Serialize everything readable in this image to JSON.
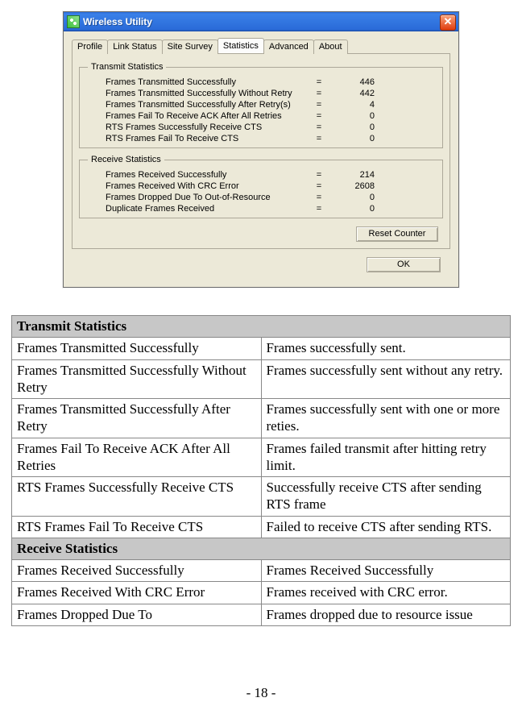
{
  "window": {
    "title": "Wireless Utility",
    "tabs": [
      "Profile",
      "Link Status",
      "Site Survey",
      "Statistics",
      "Advanced",
      "About"
    ],
    "activeTab": 3,
    "transmit": {
      "legend": "Transmit Statistics",
      "rows": [
        {
          "label": "Frames Transmitted Successfully",
          "value": "446"
        },
        {
          "label": "Frames Transmitted Successfully Without Retry",
          "value": "442"
        },
        {
          "label": "Frames Transmitted Successfully After Retry(s)",
          "value": "4"
        },
        {
          "label": "Frames Fail To Receive ACK After All Retries",
          "value": "0"
        },
        {
          "label": "RTS Frames Successfully Receive CTS",
          "value": "0"
        },
        {
          "label": "RTS Frames Fail To Receive CTS",
          "value": "0"
        }
      ]
    },
    "receive": {
      "legend": "Receive Statistics",
      "rows": [
        {
          "label": "Frames Received Successfully",
          "value": "214"
        },
        {
          "label": "Frames Received With CRC Error",
          "value": "2608"
        },
        {
          "label": "Frames Dropped Due To Out-of-Resource",
          "value": "0"
        },
        {
          "label": "Duplicate Frames Received",
          "value": "0"
        }
      ]
    },
    "buttons": {
      "reset": "Reset Counter",
      "ok": "OK"
    }
  },
  "defs": {
    "sections": [
      {
        "header": "Transmit Statistics",
        "rows": [
          {
            "l": "Frames Transmitted Successfully",
            "r": "Frames successfully sent."
          },
          {
            "l": "Frames Transmitted Successfully Without Retry",
            "r": "Frames successfully sent without any retry."
          },
          {
            "l": "Frames Transmitted Successfully After Retry",
            "r": "Frames successfully sent with one or more reties."
          },
          {
            "l": "Frames Fail To Receive ACK After All Retries",
            "r": "Frames failed transmit after hitting retry limit."
          },
          {
            "l": "RTS Frames Successfully Receive CTS",
            "r": "Successfully receive CTS after sending RTS frame"
          },
          {
            "l": "RTS Frames Fail To Receive CTS",
            "r": "Failed to receive CTS after sending RTS."
          }
        ]
      },
      {
        "header": "Receive Statistics",
        "rows": [
          {
            "l": "Frames Received Successfully",
            "r": "Frames Received Successfully"
          },
          {
            "l": "Frames Received With CRC Error",
            "r": "Frames received with CRC error."
          },
          {
            "l": "Frames Dropped Due To",
            "r": "Frames dropped due to resource issue"
          }
        ]
      }
    ]
  },
  "eq": "=",
  "pageNumber": "- 18 -"
}
